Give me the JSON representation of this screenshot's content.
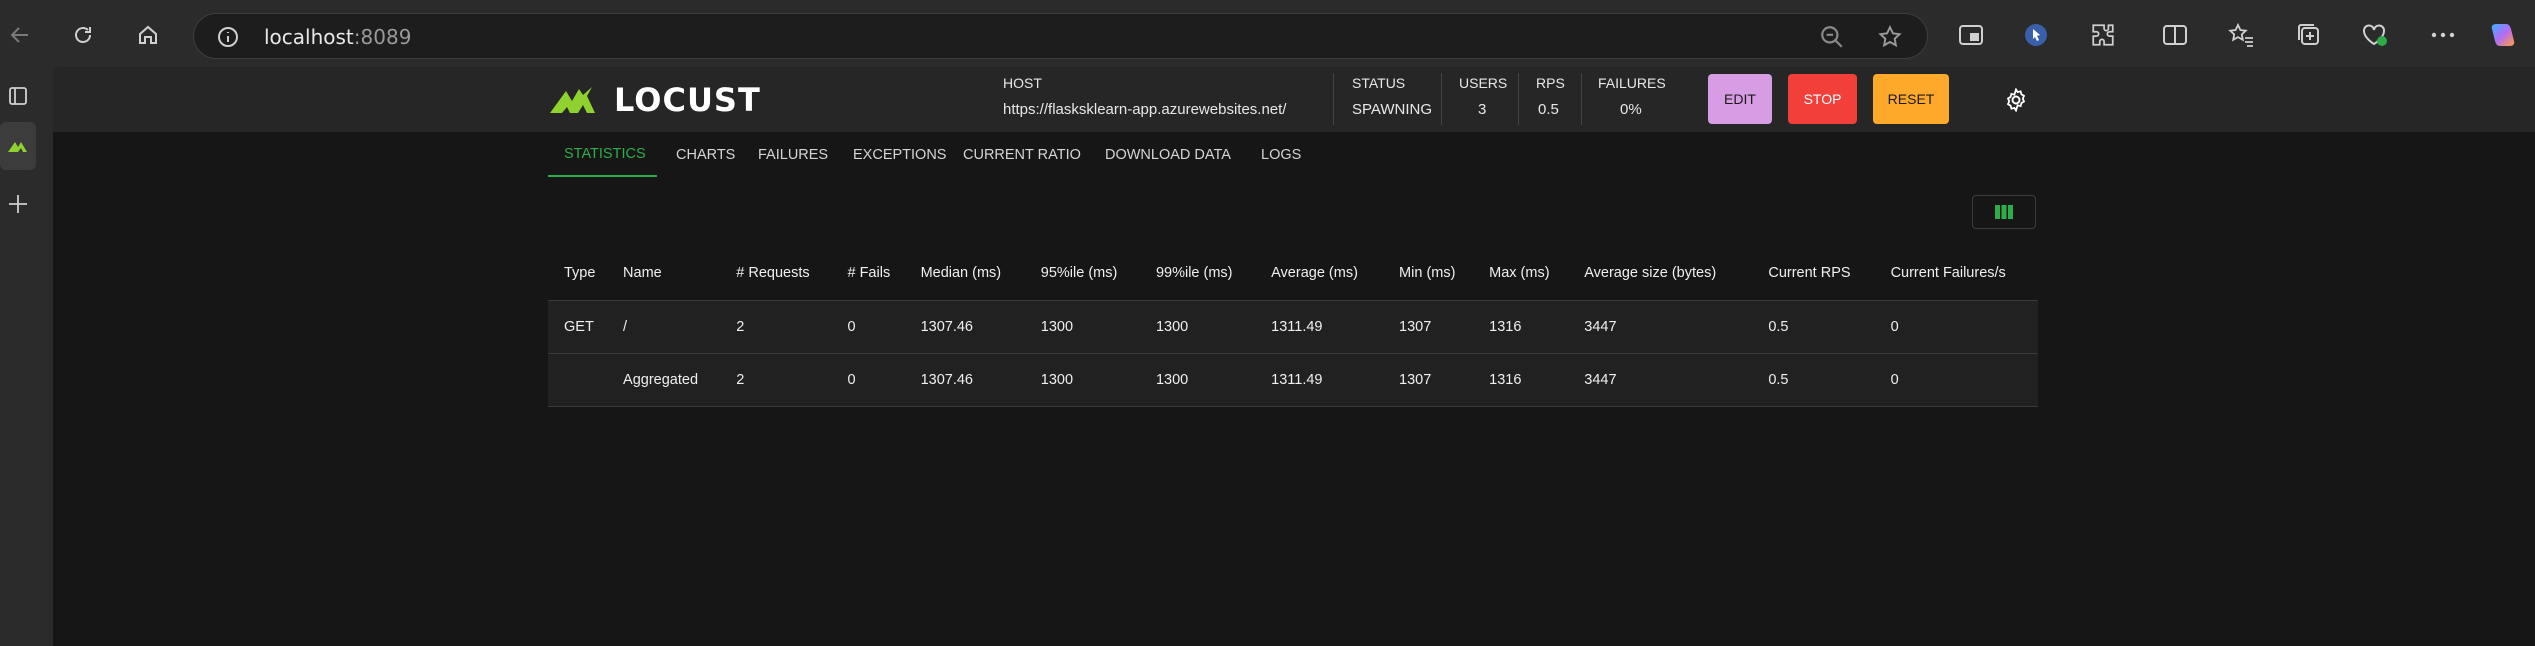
{
  "browser": {
    "address_host": "localhost",
    "address_port": ":8089"
  },
  "header": {
    "logo_text": "LOCUST",
    "host_label": "HOST",
    "host_value": "https://flasksklearn-app.azurewebsites.net/",
    "status_label": "STATUS",
    "status_value": "SPAWNING",
    "users_label": "USERS",
    "users_value": "3",
    "rps_label": "RPS",
    "rps_value": "0.5",
    "failures_label": "FAILURES",
    "failures_value": "0%",
    "edit_label": "EDIT",
    "stop_label": "STOP",
    "reset_label": "RESET"
  },
  "colors": {
    "accent": "#2eac4a",
    "edit_btn": "#d79ce3",
    "stop_btn": "#f23f3a",
    "reset_btn": "#ffa92b",
    "logo_green": "#8fd12e"
  },
  "tabs": [
    {
      "label": "STATISTICS",
      "active": true
    },
    {
      "label": "CHARTS",
      "active": false
    },
    {
      "label": "FAILURES",
      "active": false
    },
    {
      "label": "EXCEPTIONS",
      "active": false
    },
    {
      "label": "CURRENT RATIO",
      "active": false
    },
    {
      "label": "DOWNLOAD DATA",
      "active": false
    },
    {
      "label": "LOGS",
      "active": false
    }
  ],
  "table": {
    "columns": [
      "Type",
      "Name",
      "# Requests",
      "# Fails",
      "Median (ms)",
      "95%ile (ms)",
      "99%ile (ms)",
      "Average (ms)",
      "Min (ms)",
      "Max (ms)",
      "Average size (bytes)",
      "Current RPS",
      "Current Failures/s"
    ],
    "rows": [
      [
        "GET",
        "/",
        "2",
        "0",
        "1307.46",
        "1300",
        "1300",
        "1311.49",
        "1307",
        "1316",
        "3447",
        "0.5",
        "0"
      ],
      [
        "",
        "Aggregated",
        "2",
        "0",
        "1307.46",
        "1300",
        "1300",
        "1311.49",
        "1307",
        "1316",
        "3447",
        "0.5",
        "0"
      ]
    ]
  },
  "icons": {
    "back": "back-arrow-icon",
    "refresh": "refresh-icon",
    "home": "home-icon",
    "info": "info-icon",
    "zoom": "zoom-out-icon",
    "favorite": "star-icon",
    "settings": "gear-icon",
    "columns": "columns-icon"
  }
}
